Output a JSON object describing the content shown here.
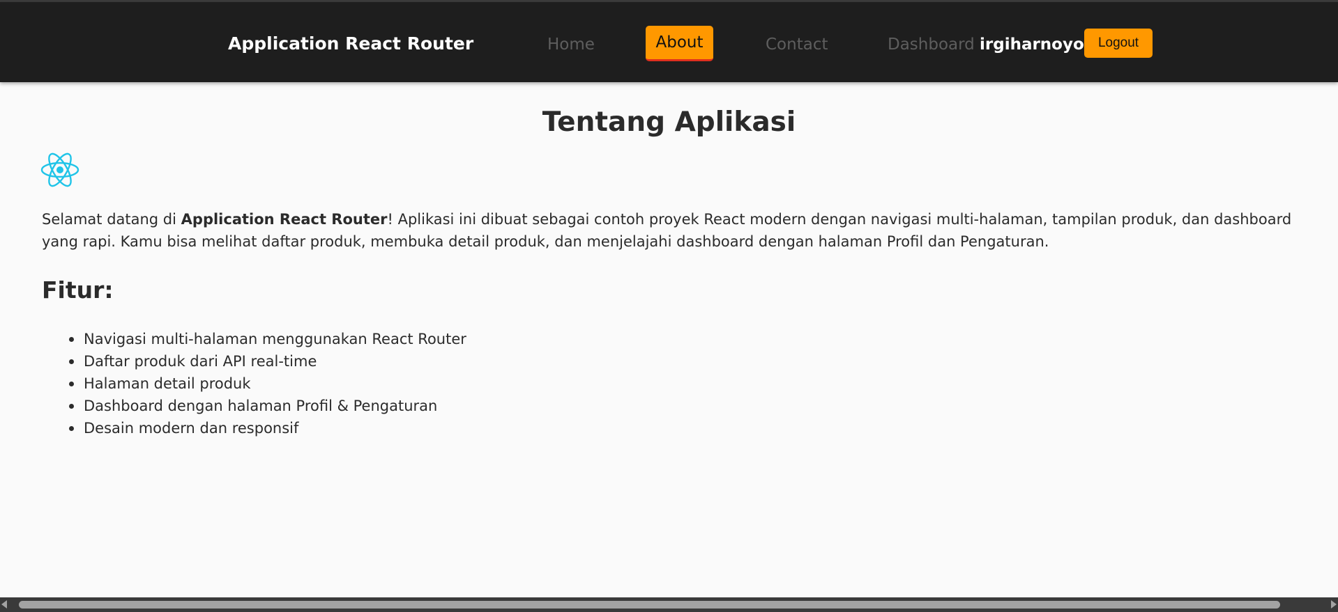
{
  "navbar": {
    "brand": "Application React Router",
    "links": {
      "home": "Home",
      "about": "About",
      "contact": "Contact",
      "dashboard": "Dashboard"
    },
    "active_link": "About",
    "username": "irgiharnoyo",
    "logout_label": "Logout"
  },
  "main": {
    "title": "Tentang Aplikasi",
    "logo_icon": "react-atom-icon",
    "intro": {
      "prefix": "Selamat datang di ",
      "app_name": "Application React Router",
      "suffix": "! Aplikasi ini dibuat sebagai contoh proyek React modern dengan navigasi multi-halaman, tampilan produk, dan dashboard yang rapi. Kamu bisa melihat daftar produk, membuka detail produk, dan menjelajahi dashboard dengan halaman Profil dan Pengaturan."
    },
    "features_heading": "Fitur:",
    "features": [
      "Navigasi multi-halaman menggunakan React Router",
      "Daftar produk dari API real-time",
      "Halaman detail produk",
      "Dashboard dengan halaman Profil & Pengaturan",
      "Desain modern dan responsif"
    ]
  },
  "colors": {
    "navbar_bg": "#1e1e1e",
    "accent": "#ff9800",
    "active_underline": "#e0301e",
    "page_bg": "#fafafa",
    "react_logo": "#1fc4e8"
  }
}
